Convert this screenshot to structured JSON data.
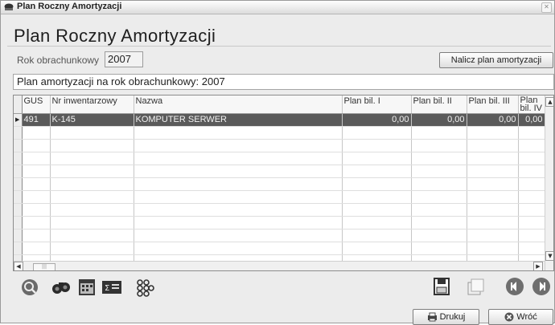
{
  "window": {
    "title": "Plan Roczny Amortyzacji",
    "icon": "app-icon"
  },
  "header": {
    "title": "Plan Roczny Amortyzacji"
  },
  "rok": {
    "label": "Rok obrachunkowy",
    "value": "2007"
  },
  "actions": {
    "nalicz_label": "Nalicz plan amortyzacji"
  },
  "info": {
    "text": "Plan amortyzacji na rok obrachunkowy: 2007"
  },
  "grid": {
    "columns": [
      "GUS",
      "Nr inwentarzowy",
      "Nazwa",
      "Plan bil. I",
      "Plan bil. II",
      "Plan bil. III",
      "Plan bil. IV"
    ],
    "rows": [
      {
        "gus": "491",
        "nr": "K-145",
        "nazwa": "KOMPUTER SERWER",
        "p1": "0,00",
        "p2": "0,00",
        "p3": "0,00",
        "p4": "0,00",
        "selected": true
      }
    ],
    "empty_rows": 11
  },
  "toolbar_left": [
    "search-doc-icon",
    "binoculars-icon",
    "calendar-filter-icon",
    "sum-icon",
    "grid-dots-icon"
  ],
  "toolbar_right": [
    "save-icon",
    "copy-icon",
    "prev-icon",
    "next-icon"
  ],
  "footer": {
    "print_label": "Drukuj",
    "back_label": "Wróć"
  },
  "colors": {
    "selected_row": "#5a5a5a",
    "window_bg": "#ececec"
  }
}
